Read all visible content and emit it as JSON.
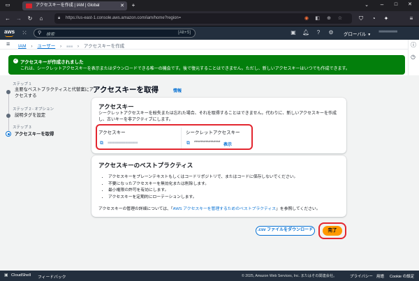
{
  "browser": {
    "tab_title": "アクセスキーを作成 | IAM | Global",
    "url": "https://us-east-1.console.aws.amazon.com/iam/home?region=",
    "icons": [
      "window-icon",
      "close-icon",
      "back-icon",
      "forward-icon",
      "reload-icon",
      "shield-icon",
      "lock-icon",
      "extension-icon",
      "bookmark-icon",
      "menu-icon"
    ]
  },
  "awsbar": {
    "logo": "aws",
    "services_icon": "grid-icon",
    "search_placeholder": "検索",
    "search_shortcut": "[Alt+S]",
    "region": "グローバル",
    "account": "■■■■■■■■■■"
  },
  "breadcrumb": {
    "items": [
      "IAM",
      "ユーザー",
      "■■■",
      "アクセスキーを作成"
    ]
  },
  "banner": {
    "title": "アクセスキーが作成されました",
    "text": "これは、シークレットアクセスキーを表示またはダウンロードできる唯一の機会です。後で復元することはできません。ただし、新しいアクセスキーはいつでも作成できます。",
    "color": "#037f0c"
  },
  "steps": [
    {
      "number": "ステップ 1",
      "label": "主要なベストプラクティスと代替案にアクセスする"
    },
    {
      "number": "ステップ 2 - オプション",
      "label": "説明タグを設定"
    },
    {
      "number": "ステップ 3",
      "label": "アクセスキーを取得"
    }
  ],
  "main": {
    "title": "アクセスキーを取得",
    "info": "情報",
    "key_panel": {
      "heading": "アクセスキー",
      "description": "シークレットアクセスキーを紛失または忘れた場合、それを取得することはできません。代わりに、新しいアクセスキーを作成し、古いキーを非アクティブにします。",
      "col_access_key": "アクセスキー",
      "col_secret_key": "シークレットアクセスキー",
      "access_key_value": "■■■■■■■■■■■■■■■■■",
      "secret_key_value": "****************",
      "show_label": "表示"
    },
    "best_practices": {
      "heading": "アクセスキーのベストプラクティス",
      "items": [
        "アクセスキーをプレーンテキストもしくはコードリポジトリで、またはコードに保存しないでください。",
        "不要になったアクセスキーを無効化または削除します。",
        "最小権限の許可を有効にします。",
        "アクセスキーを定期的にローテーションします。"
      ],
      "footer_prefix": "アクセスキーの管理の詳細については、「",
      "footer_link": "AWS アクセスキーを管理するためのベストプラクティス",
      "footer_suffix": "」を参照してください。"
    },
    "download_button": ".csv ファイルをダウンロード",
    "done_button": "完了"
  },
  "footer": {
    "cloudshell": "CloudShell",
    "feedback": "フィードバック",
    "copyright": "© 2025, Amazon Web Services, Inc. またはその関連会社。",
    "privacy": "プライバシー",
    "terms": "用語",
    "cookie": "Cookie の設定"
  }
}
